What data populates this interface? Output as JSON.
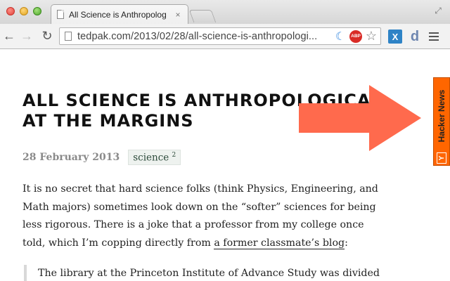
{
  "browser": {
    "tab_title": "All Science is Anthropolog",
    "tab_close": "×",
    "url": "tedpak.com/2013/02/28/all-science-is-anthropologi...",
    "extensions": {
      "abp": "ABP",
      "x": "X",
      "d": "d"
    }
  },
  "article": {
    "title": "All Science is Anthropological at the Margins",
    "date": "28 February 2013",
    "tag": "science",
    "tag_count": "2",
    "paragraph_before_link": "It is no secret that hard science folks (think Physics, Engineering, and Math majors) sometimes look down on the “softer” sciences for being less rigorous. There is a joke that a professor from my college once told, which I’m copping directly from ",
    "link_text": "a former classmate’s blog",
    "paragraph_after_link": ":",
    "quote": "The library at the Princeton Institute of Advance Study was divided"
  },
  "sidebar_tab": {
    "label": "Hacker News",
    "logo": "Y",
    "color": "#ff6600"
  },
  "overlay": {
    "arrow_color": "#ff6a4d"
  }
}
